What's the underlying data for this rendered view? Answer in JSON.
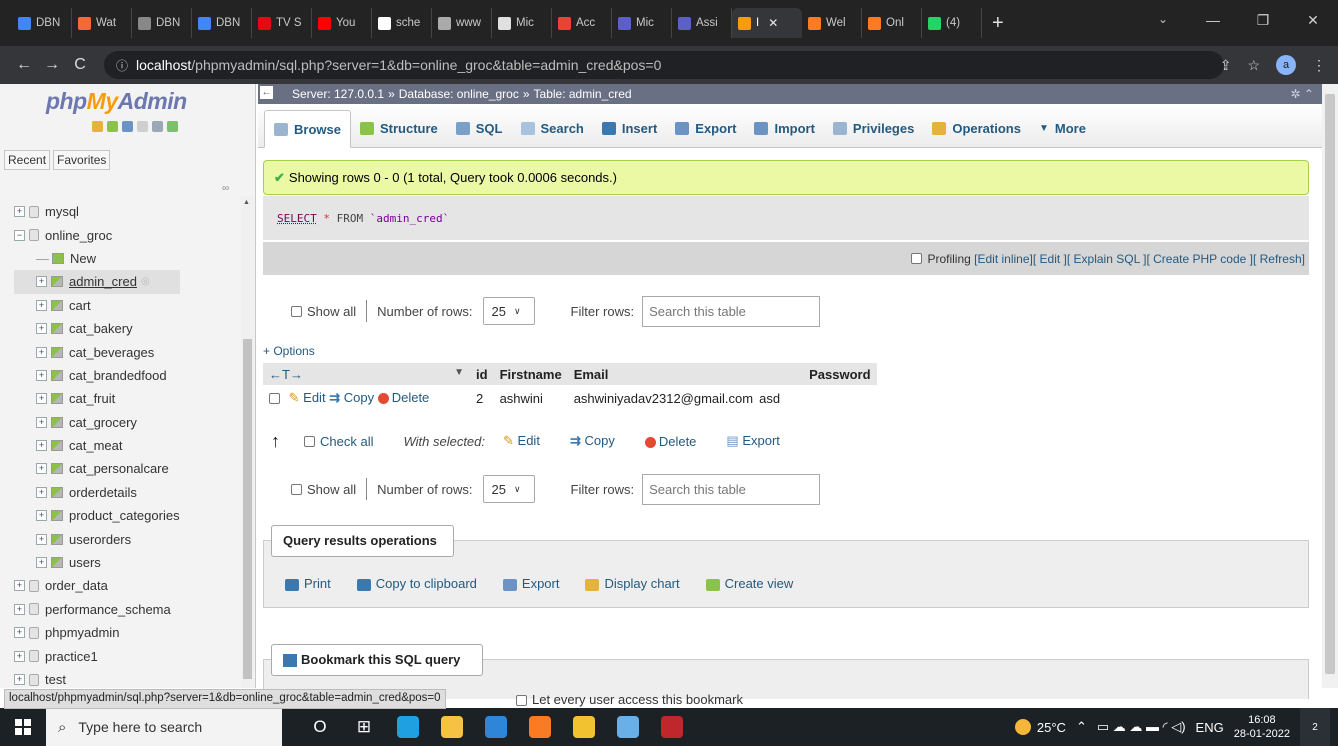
{
  "browser": {
    "tabs": [
      {
        "label": "DBN",
        "color": "#4285f4"
      },
      {
        "label": "Wat",
        "color": "#f06a35"
      },
      {
        "label": "DBN",
        "color": "#888888"
      },
      {
        "label": "DBN",
        "color": "#4285f4"
      },
      {
        "label": "TV S",
        "color": "#e50914"
      },
      {
        "label": "You",
        "color": "#ff0000"
      },
      {
        "label": "sche",
        "color": "#ffffff"
      },
      {
        "label": "www",
        "color": "#aaaaaa"
      },
      {
        "label": "Mic",
        "color": "#e0e0e0"
      },
      {
        "label": "Acc",
        "color": "#ea4335"
      },
      {
        "label": "Mic",
        "color": "#5b5fc7"
      },
      {
        "label": "Assi",
        "color": "#5b5fc7"
      },
      {
        "label": "I",
        "color": "#f89c0e",
        "active": true
      },
      {
        "label": "Wel",
        "color": "#fb7a24"
      },
      {
        "label": "Onl",
        "color": "#fb7a24"
      },
      {
        "label": "(4)",
        "color": "#25d366"
      }
    ],
    "new_tab": "+",
    "close_glyph": "✕",
    "url_host": "localhost",
    "url_path": "/phpmyadmin/sql.php?server=1&db=online_groc&table=admin_cred&pos=0",
    "profile_initial": "a"
  },
  "nav": {
    "logo_php": "php",
    "logo_my": "My",
    "logo_admin": "Admin",
    "recent": "Recent",
    "favorites": "Favorites",
    "tree": [
      {
        "label": "mysql",
        "type": "db",
        "exp": "+"
      },
      {
        "label": "online_groc",
        "type": "db",
        "exp": "−"
      },
      {
        "label": "New",
        "type": "new",
        "indent": true
      },
      {
        "label": "admin_cred",
        "type": "table",
        "indent": true,
        "active": true
      },
      {
        "label": "cart",
        "type": "table",
        "indent": true
      },
      {
        "label": "cat_bakery",
        "type": "table",
        "indent": true
      },
      {
        "label": "cat_beverages",
        "type": "table",
        "indent": true
      },
      {
        "label": "cat_brandedfood",
        "type": "table",
        "indent": true
      },
      {
        "label": "cat_fruit",
        "type": "table",
        "indent": true
      },
      {
        "label": "cat_grocery",
        "type": "table",
        "indent": true
      },
      {
        "label": "cat_meat",
        "type": "table",
        "indent": true
      },
      {
        "label": "cat_personalcare",
        "type": "table",
        "indent": true
      },
      {
        "label": "orderdetails",
        "type": "table",
        "indent": true
      },
      {
        "label": "product_categories",
        "type": "table",
        "indent": true
      },
      {
        "label": "userorders",
        "type": "table",
        "indent": true
      },
      {
        "label": "users",
        "type": "table",
        "indent": true
      },
      {
        "label": "order_data",
        "type": "db",
        "exp": "+"
      },
      {
        "label": "performance_schema",
        "type": "db",
        "exp": "+"
      },
      {
        "label": "phpmyadmin",
        "type": "db",
        "exp": "+"
      },
      {
        "label": "practice1",
        "type": "db",
        "exp": "+"
      },
      {
        "label": "test",
        "type": "db",
        "exp": "+"
      }
    ]
  },
  "breadcrumb": {
    "server": "Server: 127.0.0.1",
    "database": "Database: online_groc",
    "table": "Table: admin_cred",
    "sep": "»"
  },
  "menu_tabs": [
    {
      "label": "Browse",
      "color": "#9bb4d0",
      "active": true
    },
    {
      "label": "Structure",
      "color": "#8bc34a"
    },
    {
      "label": "SQL",
      "color": "#7aa0c8"
    },
    {
      "label": "Search",
      "color": "#a9c2de"
    },
    {
      "label": "Insert",
      "color": "#3a78b0"
    },
    {
      "label": "Export",
      "color": "#6b93c4"
    },
    {
      "label": "Import",
      "color": "#6b93c4"
    },
    {
      "label": "Privileges",
      "color": "#9bb4d0"
    },
    {
      "label": "Operations",
      "color": "#e6b33a"
    },
    {
      "label": "More",
      "color": "none",
      "caret": "▼"
    }
  ],
  "message": {
    "success": "Showing rows 0 - 0 (1 total, Query took 0.0006 seconds.)",
    "sql_select": "SELECT",
    "sql_star": "*",
    "sql_from": "FROM",
    "sql_table": "`admin_cred`"
  },
  "sql_links": {
    "profiling": "Profiling",
    "edit_inline": "[Edit inline]",
    "edit": "[ Edit ]",
    "explain": "[ Explain SQL ]",
    "create_php": "[ Create PHP code ]",
    "refresh": "[ Refresh]"
  },
  "navigation": {
    "show_all": "Show all",
    "number_of_rows": "Number of rows:",
    "rows_value": "25",
    "filter_rows": "Filter rows:",
    "search_placeholder": "Search this table"
  },
  "options_link": "+ Options",
  "table": {
    "sort_arrows": "←T→",
    "headers": [
      "id",
      "Firstname",
      "Email",
      "Password"
    ],
    "rows": [
      {
        "edit": "Edit",
        "copy": "Copy",
        "delete": "Delete",
        "id": "2",
        "firstname": "ashwini",
        "email": "ashwiniyadav2312@gmail.com",
        "password": "asd"
      }
    ]
  },
  "bulk": {
    "check_all": "Check all",
    "with_selected": "With selected:",
    "edit": "Edit",
    "copy": "Copy",
    "delete": "Delete",
    "export": "Export"
  },
  "query_ops": {
    "legend": "Query results operations",
    "links": [
      {
        "label": "Print",
        "color": "#3a78b0"
      },
      {
        "label": "Copy to clipboard",
        "color": "#3a78b0"
      },
      {
        "label": "Export",
        "color": "#6b93c4"
      },
      {
        "label": "Display chart",
        "color": "#e6b33a"
      },
      {
        "label": "Create view",
        "color": "#8bc34a"
      }
    ]
  },
  "bookmark": {
    "legend": "Bookmark this SQL query",
    "public": "Let every user access this bookmark"
  },
  "statusbar_url": "localhost/phpmyadmin/sql.php?server=1&db=online_groc&table=admin_cred&pos=0",
  "taskbar": {
    "search_placeholder": "Type here to search",
    "apps": [
      {
        "name": "cortana",
        "color": "#1c2126",
        "glyph": "O"
      },
      {
        "name": "task-view",
        "color": "#1c2126",
        "glyph": "⊞"
      },
      {
        "name": "edge",
        "color": "#1fa0e0"
      },
      {
        "name": "file-explorer",
        "color": "#f5c242"
      },
      {
        "name": "mail",
        "color": "#2f86d8"
      },
      {
        "name": "xampp",
        "color": "#fb7a24"
      },
      {
        "name": "chrome",
        "color": "#f2c230"
      },
      {
        "name": "photos",
        "color": "#6ab0e8"
      },
      {
        "name": "mcafee",
        "color": "#c0272d"
      }
    ],
    "temperature": "25°C",
    "language": "ENG",
    "time": "16:08",
    "date": "28-01-2022",
    "notification_count": "2"
  }
}
